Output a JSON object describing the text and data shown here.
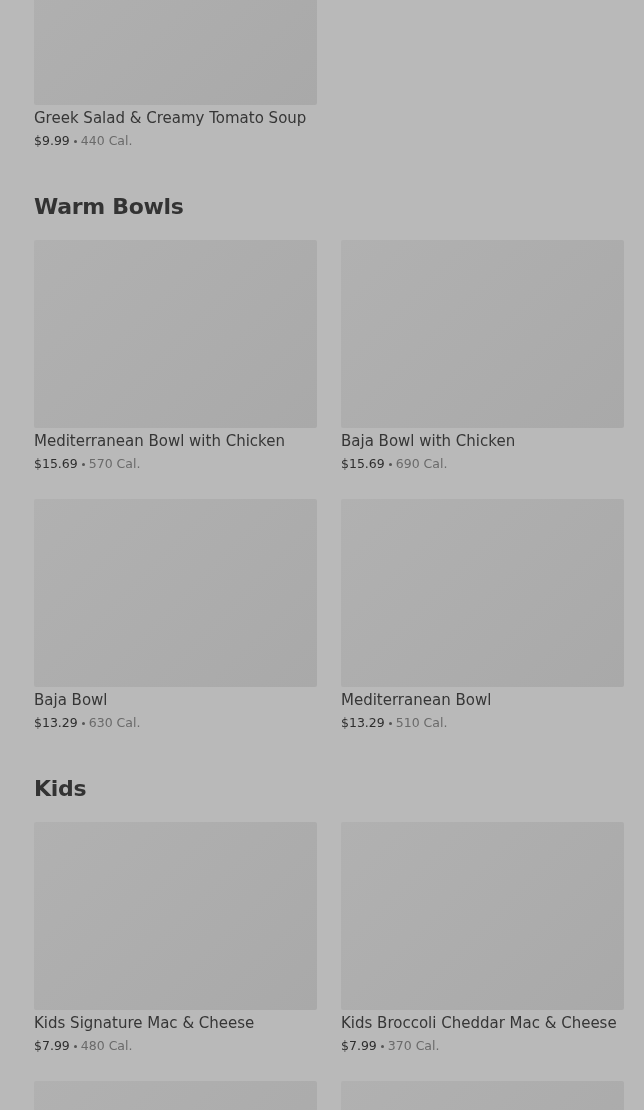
{
  "sections": [
    {
      "items": [
        {
          "kind": "dish",
          "name": "Greek Salad & Creamy Tomato Soup",
          "price": "$9.99",
          "calories": "440 Cal."
        }
      ]
    },
    {
      "title": "Warm Bowls",
      "items": [
        {
          "kind": "dish",
          "name": "Mediterranean Bowl with Chicken",
          "price": "$15.69",
          "calories": "570 Cal."
        },
        {
          "kind": "dish",
          "name": "Baja Bowl with Chicken",
          "price": "$15.69",
          "calories": "690 Cal."
        },
        {
          "kind": "dish",
          "name": "Baja Bowl",
          "price": "$13.29",
          "calories": "630 Cal."
        },
        {
          "kind": "dish",
          "name": "Mediterranean Bowl",
          "price": "$13.29",
          "calories": "510 Cal."
        }
      ]
    },
    {
      "title": "Kids",
      "items": [
        {
          "kind": "dish",
          "name": "Kids Signature Mac & Cheese",
          "price": "$7.99",
          "calories": "480 Cal."
        },
        {
          "kind": "dish",
          "name": "Kids Broccoli Cheddar Mac & Cheese",
          "price": "$7.99",
          "calories": "370 Cal."
        },
        {
          "kind": "picture"
        },
        {
          "kind": "picture"
        }
      ]
    }
  ]
}
